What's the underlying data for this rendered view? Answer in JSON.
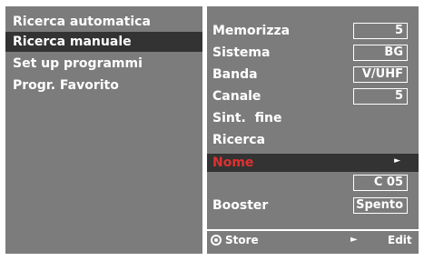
{
  "left_menu": {
    "items": [
      {
        "label": "Ricerca automatica"
      },
      {
        "label": "Ricerca manuale"
      },
      {
        "label": "Set up programmi"
      },
      {
        "label": "Progr. Favorito"
      }
    ],
    "selected_index": 1
  },
  "right_panel": {
    "rows": {
      "memorizza": {
        "label": "Memorizza",
        "value": "5"
      },
      "sistema": {
        "label": "Sistema",
        "value": "BG"
      },
      "banda": {
        "label": "Banda",
        "value": "V/UHF"
      },
      "canale": {
        "label": "Canale",
        "value": "5"
      },
      "sint_fine": {
        "label": "Sint.  fine"
      },
      "ricerca": {
        "label": "Ricerca"
      },
      "nome": {
        "label": "Nome",
        "arrow": "►",
        "value": "C 05"
      },
      "booster": {
        "label": "Booster",
        "value": "Spento"
      }
    },
    "footer": {
      "store_label": "Store",
      "edit_arrow": "►",
      "edit_label": "Edit"
    }
  },
  "colors": {
    "panel": "#7c7c7c",
    "highlight": "#333333",
    "text": "#ffffff",
    "nome_text": "#e03030"
  }
}
